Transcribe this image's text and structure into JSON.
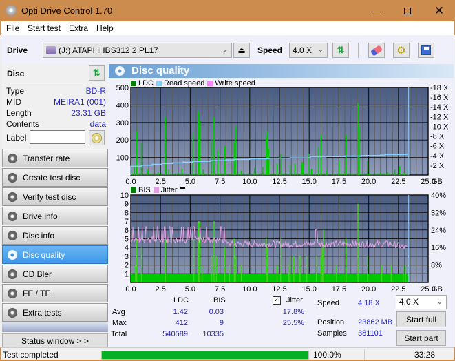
{
  "window": {
    "title": "Opti Drive Control 1.70",
    "controls": [
      "minimize",
      "maximize",
      "close"
    ]
  },
  "menu": [
    "File",
    "Start test",
    "Extra",
    "Help"
  ],
  "toolbar": {
    "drive_label": "Drive",
    "drive_value": "(J:)  ATAPI iHBS312  2 PL17",
    "speed_label": "Speed",
    "speed_value": "4.0 X"
  },
  "disc_panel": {
    "title": "Disc",
    "fields": [
      {
        "label": "Type",
        "value": "BD-R"
      },
      {
        "label": "MID",
        "value": "MEIRA1 (001)"
      },
      {
        "label": "Length",
        "value": "23.31 GB"
      },
      {
        "label": "Contents",
        "value": "data"
      }
    ],
    "label_field_label": "Label",
    "label_value": ""
  },
  "nav": [
    {
      "label": "Transfer rate",
      "active": false
    },
    {
      "label": "Create test disc",
      "active": false
    },
    {
      "label": "Verify test disc",
      "active": false
    },
    {
      "label": "Drive info",
      "active": false
    },
    {
      "label": "Disc info",
      "active": false
    },
    {
      "label": "Disc quality",
      "active": true
    },
    {
      "label": "CD Bler",
      "active": false
    },
    {
      "label": "FE / TE",
      "active": false
    },
    {
      "label": "Extra tests",
      "active": false
    }
  ],
  "status_window_label": "Status window > >",
  "panel_title": "Disc quality",
  "chart_data": [
    {
      "type": "bar",
      "title": "LDC / Read speed",
      "legend": [
        "LDC",
        "Read speed",
        "Write speed"
      ],
      "legend_colors": [
        "#008000",
        "#87cefa",
        "#ff80ff"
      ],
      "xlabel": "GB",
      "xlim": [
        0,
        25
      ],
      "x_ticks": [
        "0.0",
        "2.5",
        "5.0",
        "7.5",
        "10.0",
        "12.5",
        "15.0",
        "17.5",
        "20.0",
        "22.5",
        "25.0"
      ],
      "ylim": [
        0,
        500
      ],
      "y_ticks": [
        "100",
        "200",
        "300",
        "400",
        "500"
      ],
      "y2lim": [
        0,
        18
      ],
      "y2_ticks": [
        "2 X",
        "4 X",
        "6 X",
        "8 X",
        "10 X",
        "12 X",
        "14 X",
        "16 X",
        "18 X"
      ],
      "ldc_spikes": [
        [
          0.3,
          60
        ],
        [
          0.5,
          250
        ],
        [
          0.9,
          180
        ],
        [
          1.4,
          30
        ],
        [
          2.3,
          20
        ],
        [
          2.9,
          330
        ],
        [
          3.2,
          30
        ],
        [
          4.3,
          35
        ],
        [
          5.2,
          240
        ],
        [
          5.7,
          365
        ],
        [
          5.8,
          310
        ],
        [
          6.1,
          30
        ],
        [
          6.8,
          200
        ],
        [
          7.0,
          330
        ],
        [
          7.3,
          140
        ],
        [
          7.9,
          165
        ],
        [
          8.7,
          190
        ],
        [
          8.8,
          275
        ],
        [
          9.3,
          25
        ],
        [
          10.4,
          40
        ],
        [
          11.1,
          45
        ],
        [
          11.4,
          215
        ],
        [
          11.5,
          250
        ],
        [
          11.6,
          150
        ],
        [
          12.3,
          65
        ],
        [
          12.6,
          120
        ],
        [
          13.4,
          55
        ],
        [
          13.8,
          65
        ],
        [
          14.4,
          75
        ],
        [
          14.5,
          65
        ],
        [
          15.0,
          120
        ],
        [
          15.2,
          35
        ],
        [
          15.8,
          160
        ],
        [
          16.0,
          230
        ],
        [
          16.5,
          35
        ],
        [
          17.5,
          80
        ],
        [
          18.1,
          230
        ],
        [
          19.1,
          410
        ],
        [
          19.2,
          280
        ],
        [
          19.9,
          80
        ],
        [
          21.0,
          15
        ],
        [
          21.6,
          20
        ],
        [
          22.2,
          30
        ],
        [
          22.6,
          50
        ],
        [
          23.0,
          20
        ]
      ],
      "read_speed_steps": [
        [
          0.0,
          1.8
        ],
        [
          0.9,
          2.0
        ],
        [
          1.8,
          2.2
        ],
        [
          2.6,
          2.35
        ],
        [
          3.5,
          2.5
        ],
        [
          4.4,
          2.65
        ],
        [
          5.2,
          2.8
        ],
        [
          6.7,
          2.95
        ],
        [
          8.0,
          3.1
        ],
        [
          8.7,
          3.2
        ],
        [
          10.0,
          3.35
        ],
        [
          11.6,
          3.45
        ],
        [
          13.4,
          3.55
        ],
        [
          15.1,
          3.7
        ],
        [
          16.4,
          3.8
        ],
        [
          18.0,
          3.9
        ],
        [
          19.4,
          4.0
        ],
        [
          21.0,
          4.1
        ],
        [
          21.4,
          4.2
        ],
        [
          23.2,
          4.3
        ],
        [
          23.35,
          4.3
        ]
      ],
      "end_marker_gb": 23.35
    },
    {
      "type": "bar",
      "title": "BIS / Jitter",
      "legend": [
        "BIS",
        "Jitter"
      ],
      "legend_colors": [
        "#008000",
        "#e0a0e0"
      ],
      "xlabel": "GB",
      "xlim": [
        0,
        25
      ],
      "x_ticks": [
        "0.0",
        "2.5",
        "5.0",
        "7.5",
        "10.0",
        "12.5",
        "15.0",
        "17.5",
        "20.0",
        "22.5",
        "25.0"
      ],
      "ylim": [
        0,
        10
      ],
      "y_ticks": [
        "1",
        "2",
        "3",
        "4",
        "5",
        "6",
        "7",
        "8",
        "9",
        "10"
      ],
      "y2lim": [
        0,
        40
      ],
      "y2_ticks": [
        "8%",
        "16%",
        "24%",
        "32%",
        "40%"
      ],
      "bis_base": 1,
      "bis_spikes": [
        [
          0.4,
          2
        ],
        [
          0.5,
          5
        ],
        [
          0.9,
          4
        ],
        [
          2.9,
          5
        ],
        [
          5.3,
          5
        ],
        [
          5.7,
          7
        ],
        [
          5.8,
          7
        ],
        [
          6.0,
          2
        ],
        [
          6.8,
          3
        ],
        [
          7.0,
          7
        ],
        [
          7.2,
          3
        ],
        [
          7.9,
          4
        ],
        [
          8.3,
          2
        ],
        [
          8.7,
          5
        ],
        [
          8.8,
          3
        ],
        [
          9.3,
          2
        ],
        [
          11.4,
          5
        ],
        [
          11.5,
          4
        ],
        [
          12.3,
          2
        ],
        [
          12.6,
          5
        ],
        [
          13.3,
          2
        ],
        [
          13.4,
          3
        ],
        [
          13.7,
          3
        ],
        [
          14.2,
          3
        ],
        [
          14.3,
          3
        ],
        [
          14.8,
          3
        ],
        [
          15.6,
          3
        ],
        [
          16.0,
          3
        ],
        [
          16.1,
          4
        ],
        [
          16.2,
          6
        ],
        [
          17.3,
          2
        ],
        [
          18.1,
          5
        ],
        [
          19.1,
          9
        ],
        [
          19.9,
          3
        ],
        [
          21.1,
          2
        ],
        [
          21.9,
          2
        ],
        [
          22.9,
          2
        ],
        [
          23.1,
          2
        ]
      ],
      "jitter_mean_pct": 17.8,
      "jitter_max_pct": 25.5,
      "end_marker_gb": 23.35
    }
  ],
  "stats": {
    "headers": [
      "LDC",
      "BIS"
    ],
    "rows": [
      {
        "label": "Avg",
        "ldc": "1.42",
        "bis": "0.03",
        "jitter": "17.8%"
      },
      {
        "label": "Max",
        "ldc": "412",
        "bis": "9",
        "jitter": "25.5%"
      },
      {
        "label": "Total",
        "ldc": "540589",
        "bis": "10335"
      }
    ],
    "jitter_label": "Jitter",
    "jitter_checked": true,
    "speed_label": "Speed",
    "speed_value": "4.18 X",
    "position_label": "Position",
    "position_value": "23862 MB",
    "samples_label": "Samples",
    "samples_value": "381101",
    "speed_select": "4.0 X",
    "start_full": "Start full",
    "start_part": "Start part"
  },
  "statusbar": {
    "message": "Test completed",
    "progress_pct": 100.0,
    "progress_text": "100.0%",
    "time": "33:28"
  }
}
